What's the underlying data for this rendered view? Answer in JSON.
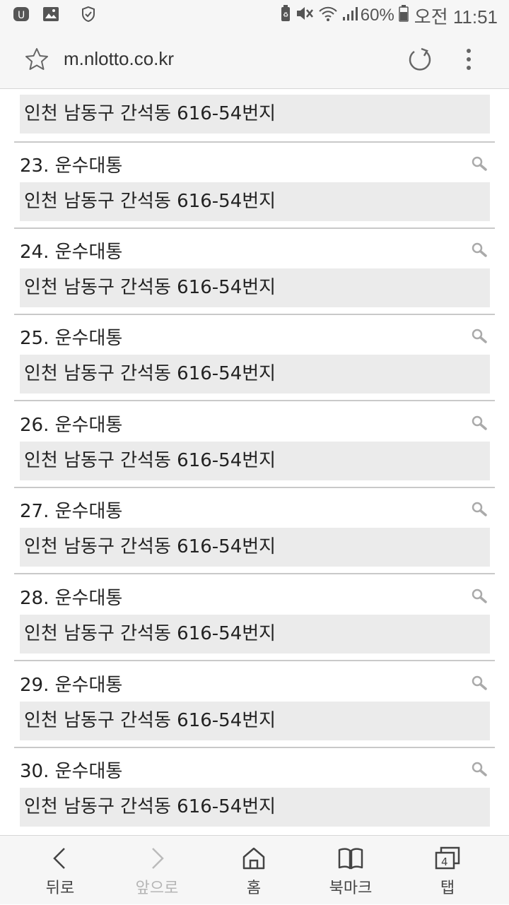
{
  "status_bar": {
    "battery_percent": "60%",
    "time": "오전 11:51",
    "icons": [
      "u-plus-icon",
      "gallery-icon",
      "shield-check-icon",
      "battery-saver-icon",
      "mute-icon",
      "wifi-icon",
      "signal-icon",
      "battery-icon"
    ]
  },
  "url_bar": {
    "url": "m.nlotto.co.kr",
    "icons": [
      "star-icon",
      "reload-icon",
      "more-vert-icon"
    ]
  },
  "list": {
    "first_address": "인천 남동구 간석동 616-54번지",
    "items": [
      {
        "title": "23. 운수대통",
        "address": "인천 남동구 간석동 616-54번지"
      },
      {
        "title": "24. 운수대통",
        "address": "인천 남동구 간석동 616-54번지"
      },
      {
        "title": "25. 운수대통",
        "address": "인천 남동구 간석동 616-54번지"
      },
      {
        "title": "26. 운수대통",
        "address": "인천 남동구 간석동 616-54번지"
      },
      {
        "title": "27. 운수대통",
        "address": "인천 남동구 간석동 616-54번지"
      },
      {
        "title": "28. 운수대통",
        "address": "인천 남동구 간석동 616-54번지"
      },
      {
        "title": "29. 운수대통",
        "address": "인천 남동구 간석동 616-54번지"
      },
      {
        "title": "30. 운수대통",
        "address": "인천 남동구 간석동 616-54번지"
      }
    ]
  },
  "bottom_nav": {
    "back_label": "뒤로",
    "forward_label": "앞으로",
    "home_label": "홈",
    "bookmarks_label": "북마크",
    "tabs_label": "탭",
    "tab_count": "4"
  }
}
